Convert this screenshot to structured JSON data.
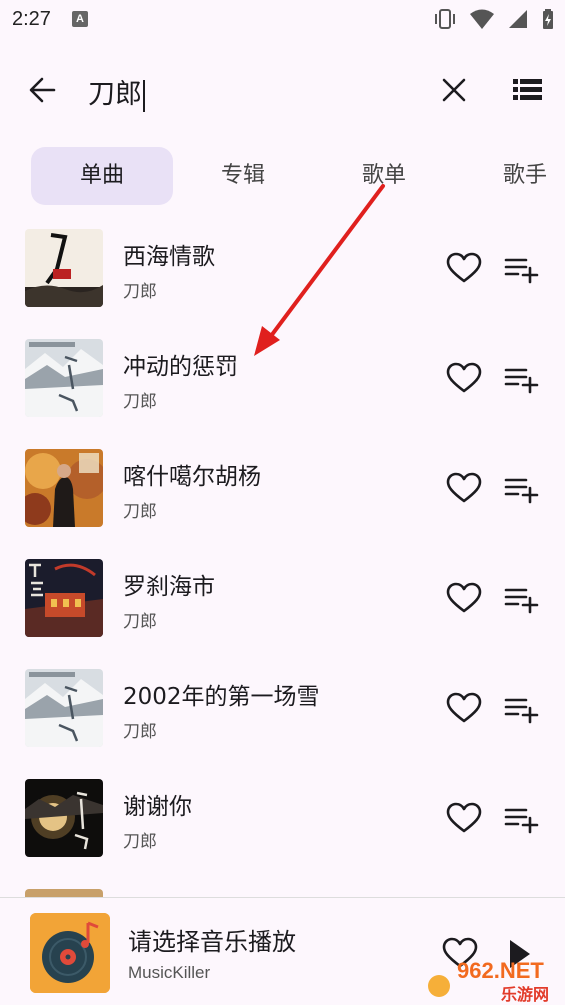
{
  "status_bar": {
    "time": "2:27",
    "notification_letter": "A"
  },
  "search": {
    "query": "刀郎"
  },
  "tabs": [
    {
      "label": "单曲",
      "active": true
    },
    {
      "label": "专辑",
      "active": false
    },
    {
      "label": "歌单",
      "active": false
    },
    {
      "label": "歌手",
      "active": false
    }
  ],
  "songs": [
    {
      "title": "西海情歌",
      "artist": "刀郎"
    },
    {
      "title": "冲动的惩罚",
      "artist": "刀郎"
    },
    {
      "title": "喀什噶尔胡杨",
      "artist": "刀郎"
    },
    {
      "title": "罗刹海市",
      "artist": "刀郎"
    },
    {
      "title": "2002年的第一场雪",
      "artist": "刀郎"
    },
    {
      "title": "谢谢你",
      "artist": "刀郎"
    }
  ],
  "player": {
    "title": "请选择音乐播放",
    "subtitle": "MusicKiller"
  },
  "colors": {
    "background": "#fdf7fd",
    "active_tab": "#e9e1f6",
    "annotation_arrow": "#e0201e",
    "player_cover": "#f2a437"
  },
  "watermark": {
    "line1": "962.NET",
    "line2": "乐游网"
  }
}
